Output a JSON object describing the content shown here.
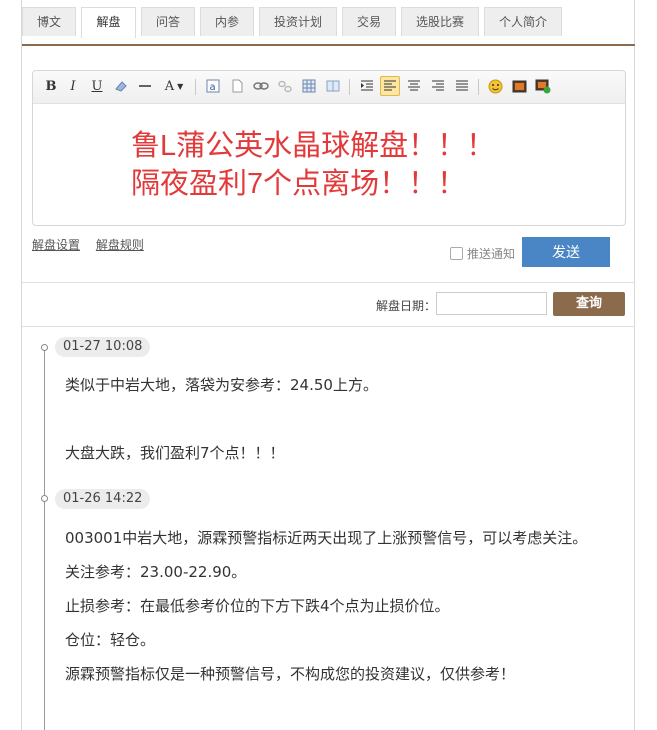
{
  "tabs": [
    {
      "label": "博文",
      "active": false
    },
    {
      "label": "解盘",
      "active": true
    },
    {
      "label": "问答",
      "active": false
    },
    {
      "label": "内参",
      "active": false
    },
    {
      "label": "投资计划",
      "active": false
    },
    {
      "label": "交易",
      "active": false
    },
    {
      "label": "选股比赛",
      "active": false
    },
    {
      "label": "个人简介",
      "active": false
    }
  ],
  "toolbar": {
    "bold": "B",
    "italic": "I",
    "underline": "U",
    "font_color": "A"
  },
  "editor": {
    "line1": "鲁L蒲公英水晶球解盘！！！",
    "line2": "隔夜盈利7个点离场！！！",
    "text_color": "#e23a3a"
  },
  "links": {
    "settings": "解盘设置",
    "rules": "解盘规则"
  },
  "push_notify_label": "推送通知",
  "send_label": "发送",
  "query": {
    "date_label": "解盘日期：",
    "date_value": "",
    "button_label": "查询"
  },
  "entries": [
    {
      "date": "01-27 10:08",
      "lines": [
        "类似于中岩大地，落袋为安参考：24.50上方。",
        "",
        "大盘大跌，我们盈利7个点！！！"
      ]
    },
    {
      "date": "01-26 14:22",
      "lines": [
        "003001中岩大地，源霖预警指标近两天出现了上涨预警信号，可以考虑关注。",
        "关注参考：23.00-22.90。",
        "止损参考：在最低参考价位的下方下跌4个点为止损价位。",
        "仓位：轻仓。",
        "源霖预警指标仅是一种预警信号，不构成您的投资建议，仅供参考！"
      ]
    }
  ],
  "colors": {
    "accent_brown": "#8b6b4c",
    "send_blue": "#4a86c6"
  }
}
